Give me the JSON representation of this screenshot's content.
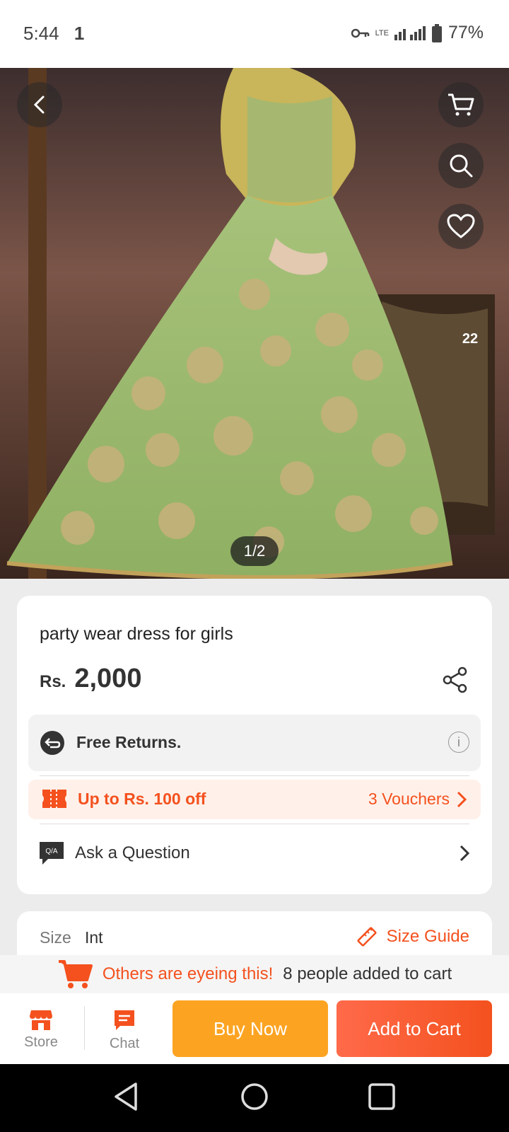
{
  "status": {
    "time": "5:44",
    "sim": "1",
    "network": "LTE",
    "battery": "77%"
  },
  "hero": {
    "image_counter": "1/2",
    "wishlist_count": "22"
  },
  "product": {
    "title": "party wear dress for girls",
    "currency": "Rs.",
    "price": "2,000",
    "returns_label": "Free Returns.",
    "voucher_label": "Up to Rs. 100 off",
    "voucher_count": "3 Vouchers",
    "qa_label": "Ask a Question"
  },
  "size": {
    "label": "Size",
    "value": "Int",
    "guide": "Size Guide"
  },
  "eyeing": {
    "highlight": "Others are eyeing this!",
    "detail": "8 people added to cart"
  },
  "bottom": {
    "store": "Store",
    "chat": "Chat",
    "buy_now": "Buy Now",
    "add_to_cart": "Add to Cart"
  },
  "colors": {
    "accent": "#f4511e",
    "buy_now": "#fca422"
  }
}
